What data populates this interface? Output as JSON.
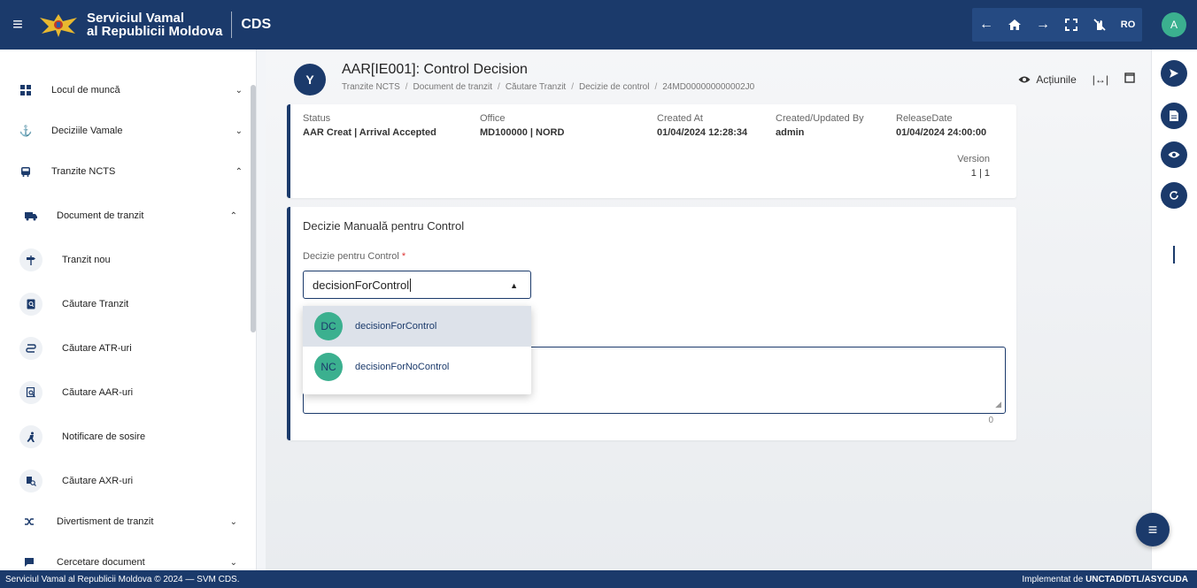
{
  "header": {
    "brand_line1": "Serviciul Vamal",
    "brand_line2": "al Republicii Moldova",
    "app_name": "CDS",
    "language": "RO",
    "user_initial": "A"
  },
  "sidebar": {
    "items": [
      {
        "label": "Locul de muncă",
        "icon": "grid-icon"
      },
      {
        "label": "Deciziile Vamale",
        "icon": "anchor-icon"
      },
      {
        "label": "Tranzite NCTS",
        "icon": "bus-icon"
      },
      {
        "label": "Document de tranzit",
        "icon": "truck-icon"
      },
      {
        "label": "Tranzit nou",
        "icon": "signpost-icon"
      },
      {
        "label": "Căutare Tranzit",
        "icon": "search-document-icon"
      },
      {
        "label": "Căutare ATR-uri",
        "icon": "route-icon"
      },
      {
        "label": "Căutare AAR-uri",
        "icon": "search-list-icon"
      },
      {
        "label": "Notificare de sosire",
        "icon": "arrival-icon"
      },
      {
        "label": "Căutare AXR-uri",
        "icon": "search-truck-icon"
      },
      {
        "label": "Divertisment de tranzit",
        "icon": "shuffle-icon"
      },
      {
        "label": "Cercetare document",
        "icon": "message-icon"
      }
    ]
  },
  "page": {
    "title": "AAR[IE001]: Control Decision",
    "breadcrumb": [
      "Tranzite NCTS",
      "Document de tranzit",
      "Căutare Tranzit",
      "Decizie de control",
      "24MD000000000002J0"
    ],
    "actions_label": "Acțiunile"
  },
  "info": {
    "status_label": "Status",
    "status_value": "AAR Creat | Arrival Accepted",
    "office_label": "Office",
    "office_value": "MD100000 | NORD",
    "created_label": "Created At",
    "created_value": "01/04/2024 12:28:34",
    "by_label": "Created/Updated By",
    "by_value": "admin",
    "release_label": "ReleaseDate",
    "release_value": "01/04/2024 24:00:00",
    "version_label": "Version",
    "version_value": "1 | 1"
  },
  "form": {
    "title": "Decizie Manuală pentru Control",
    "field_label": "Decizie pentru Control",
    "required_mark": "*",
    "selected_value": "decisionForControl",
    "char_count": "0",
    "options": [
      {
        "initials": "DC",
        "label": "decisionForControl"
      },
      {
        "initials": "NC",
        "label": "decisionForNoControl"
      }
    ]
  },
  "footer": {
    "left": "Serviciul Vamal al Republicii Moldova © 2024 — SVM CDS.",
    "right_prefix": "Implementat de ",
    "right_bold": "UNCTAD/DTL/ASYCUDA"
  }
}
